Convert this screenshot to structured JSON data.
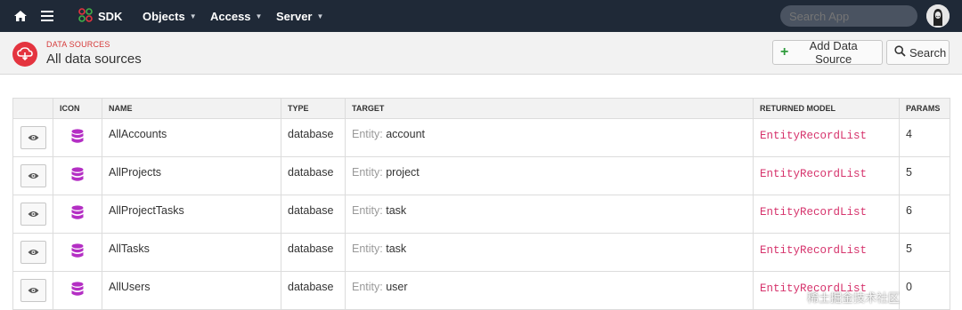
{
  "nav": {
    "brand": "SDK",
    "items": [
      {
        "label": "Objects"
      },
      {
        "label": "Access"
      },
      {
        "label": "Server"
      }
    ],
    "search_placeholder": "Search App"
  },
  "header": {
    "subtitle": "DATA SOURCES",
    "title": "All data sources",
    "add_button": "Add Data Source",
    "search_button": "Search"
  },
  "table": {
    "columns": [
      "",
      "ICON",
      "NAME",
      "TYPE",
      "TARGET",
      "RETURNED MODEL",
      "PARAMS"
    ],
    "entity_prefix": "Entity:",
    "rows": [
      {
        "name": "AllAccounts",
        "type": "database",
        "target": "account",
        "model": "EntityRecordList",
        "params": "4"
      },
      {
        "name": "AllProjects",
        "type": "database",
        "target": "project",
        "model": "EntityRecordList",
        "params": "5"
      },
      {
        "name": "AllProjectTasks",
        "type": "database",
        "target": "task",
        "model": "EntityRecordList",
        "params": "6"
      },
      {
        "name": "AllTasks",
        "type": "database",
        "target": "task",
        "model": "EntityRecordList",
        "params": "5"
      },
      {
        "name": "AllUsers",
        "type": "database",
        "target": "user",
        "model": "EntityRecordList",
        "params": "0"
      }
    ]
  },
  "colors": {
    "topbar": "#1f2937",
    "accent_red": "#e4343f",
    "db_icon": "#b42fc4",
    "model_text": "#d6336c"
  },
  "watermark": "稀土掘金技术社区"
}
